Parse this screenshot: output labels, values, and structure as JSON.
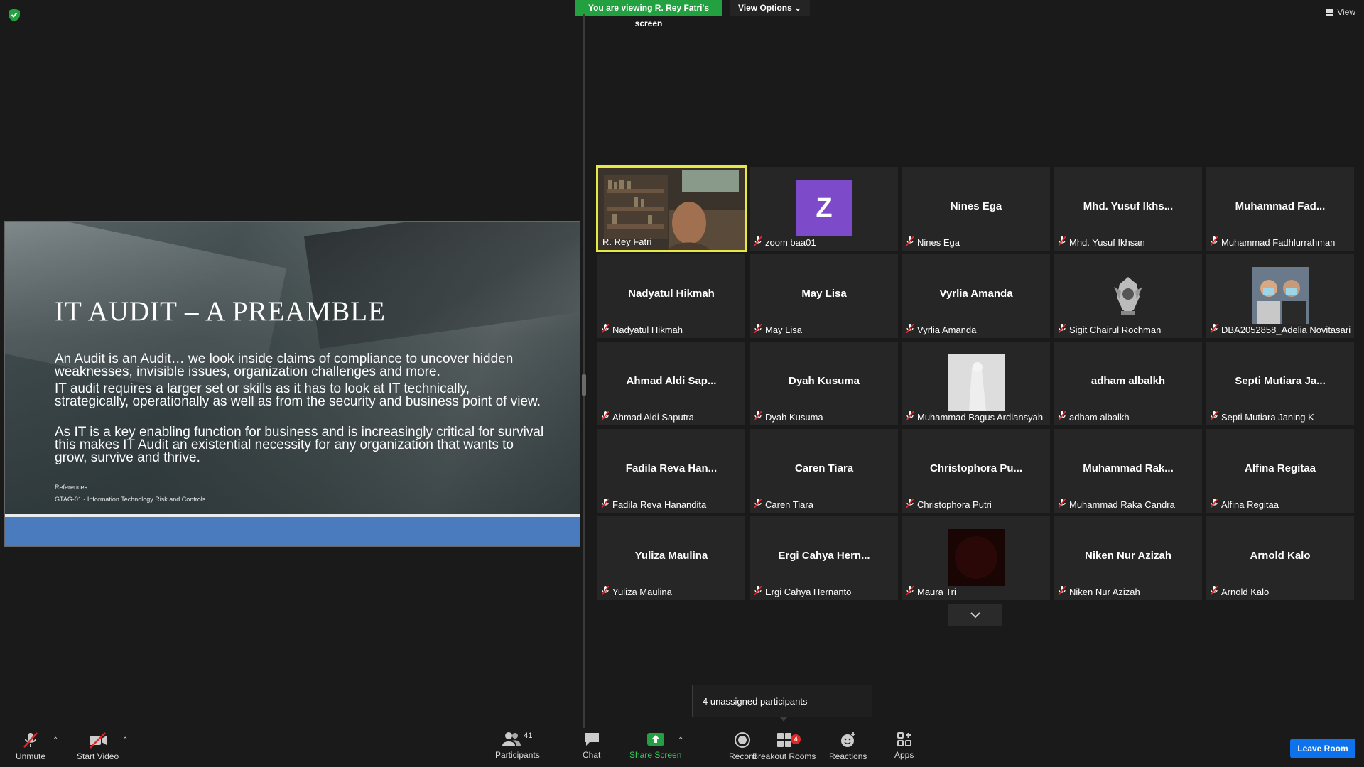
{
  "banner": {
    "viewing": "You are viewing R. Rey Fatri's screen",
    "view_options": "View Options"
  },
  "view_button": "View",
  "slide": {
    "title": "IT AUDIT – A PREAMBLE",
    "para1": "An Audit is an Audit… we look inside claims of compliance to uncover hidden weaknesses, invisible issues, organization challenges and more.",
    "para2": "IT audit requires a larger set or skills as it has to look at IT technically, strategically, operationally as well as from the security and business point of view.",
    "para3": "As IT is a key enabling function for business and is increasingly critical for survival this makes IT Audit an existential necessity for any organization that wants to grow, survive and thrive.",
    "references_label": "References:",
    "reference_item": "GTAG-01 - Information Technology Risk and Controls"
  },
  "participants": [
    {
      "big": "",
      "label": "R. Rey Fatri",
      "video": "webcam",
      "muted": false,
      "active": true
    },
    {
      "big": "",
      "label": "zoom baa01",
      "video": "avatar-z",
      "avatar_letter": "Z",
      "muted": true
    },
    {
      "big": "Nines Ega",
      "label": "Nines Ega",
      "muted": true
    },
    {
      "big": "Mhd. Yusuf Ikhs...",
      "label": "Mhd. Yusuf Ikhsan",
      "muted": true
    },
    {
      "big": "Muhammad Fad...",
      "label": "Muhammad Fadhlurrahman",
      "muted": true
    },
    {
      "big": "Nadyatul Hikmah",
      "label": "Nadyatul Hikmah",
      "muted": true
    },
    {
      "big": "May Lisa",
      "label": "May Lisa",
      "muted": true
    },
    {
      "big": "Vyrlia Amanda",
      "label": "Vyrlia Amanda",
      "muted": true
    },
    {
      "big": "",
      "label": "Sigit Chairul Rochman",
      "video": "emblem",
      "muted": true
    },
    {
      "big": "",
      "label": "DBA2052858_Adelia Novitasari",
      "video": "photo-pair",
      "muted": true
    },
    {
      "big": "Ahmad Aldi Sap...",
      "label": "Ahmad Aldi Saputra",
      "muted": true
    },
    {
      "big": "Dyah Kusuma",
      "label": "Dyah Kusuma",
      "muted": true
    },
    {
      "big": "",
      "label": "Muhammad Bagus Ardiansyah",
      "video": "photo-white",
      "muted": true
    },
    {
      "big": "adham albalkh",
      "label": "adham albalkh",
      "muted": true
    },
    {
      "big": "Septi Mutiara Ja...",
      "label": "Septi Mutiara Janing K",
      "muted": true
    },
    {
      "big": "Fadila Reva Han...",
      "label": "Fadila Reva Hanandita",
      "muted": true
    },
    {
      "big": "Caren Tiara",
      "label": "Caren Tiara",
      "muted": true
    },
    {
      "big": "Christophora Pu...",
      "label": "Christophora Putri",
      "muted": true
    },
    {
      "big": "Muhammad Rak...",
      "label": "Muhammad Raka Candra",
      "muted": true
    },
    {
      "big": "Alfina Regitaa",
      "label": "Alfina Regitaa",
      "muted": true
    },
    {
      "big": "Yuliza Maulina",
      "label": "Yuliza Maulina",
      "muted": true
    },
    {
      "big": "Ergi Cahya Hern...",
      "label": "Ergi Cahya Hernanto",
      "muted": true
    },
    {
      "big": "",
      "label": "Maura Tri",
      "video": "photo-dark",
      "muted": true
    },
    {
      "big": "Niken Nur Azizah",
      "label": "Niken Nur Azizah",
      "muted": true
    },
    {
      "big": "Arnold Kalo",
      "label": "Arnold Kalo",
      "muted": true
    }
  ],
  "tooltip": "4 unassigned participants",
  "toolbar": {
    "unmute": "Unmute",
    "start_video": "Start Video",
    "participants": "Participants",
    "participants_count": "41",
    "chat": "Chat",
    "share_screen": "Share Screen",
    "record": "Record",
    "breakout_rooms": "Breakout Rooms",
    "breakout_badge": "4",
    "reactions": "Reactions",
    "apps": "Apps",
    "leave": "Leave Room"
  },
  "colors": {
    "accent_green": "#23a140",
    "leave_blue": "#0e72ed",
    "active_border": "#e8e842",
    "muted_red": "#e02828"
  }
}
